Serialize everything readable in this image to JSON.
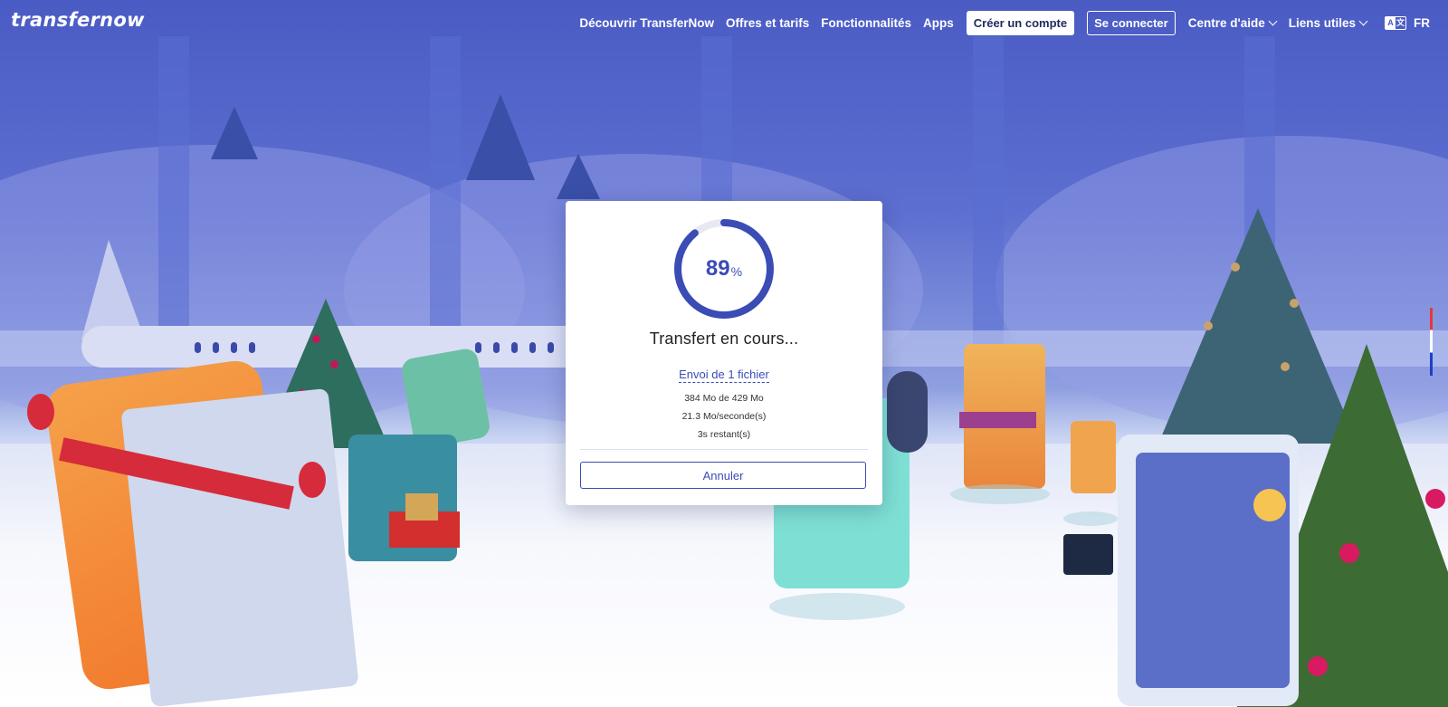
{
  "colors": {
    "brand": "#4a5bc4",
    "accent": "#3b4cb5",
    "progress_track": "#e6e8f2"
  },
  "header": {
    "logo": "transfernow",
    "nav": {
      "discover": "Découvrir TransferNow",
      "pricing": "Offres et tarifs",
      "features": "Fonctionnalités",
      "apps": "Apps",
      "create_account": "Créer un compte",
      "login": "Se connecter",
      "help_center": "Centre d'aide",
      "useful_links": "Liens utiles"
    },
    "language": {
      "icon": "translate-icon",
      "code": "FR"
    }
  },
  "transfer": {
    "progress_percent": 89,
    "percent_sign": "%",
    "status": "Transfert en cours...",
    "file_link": "Envoi de 1 fichier",
    "size_progress": "384 Mo de 429 Mo",
    "speed": "21.3 Mo/seconde(s)",
    "remaining": "3s restant(s)",
    "cancel_label": "Annuler"
  }
}
